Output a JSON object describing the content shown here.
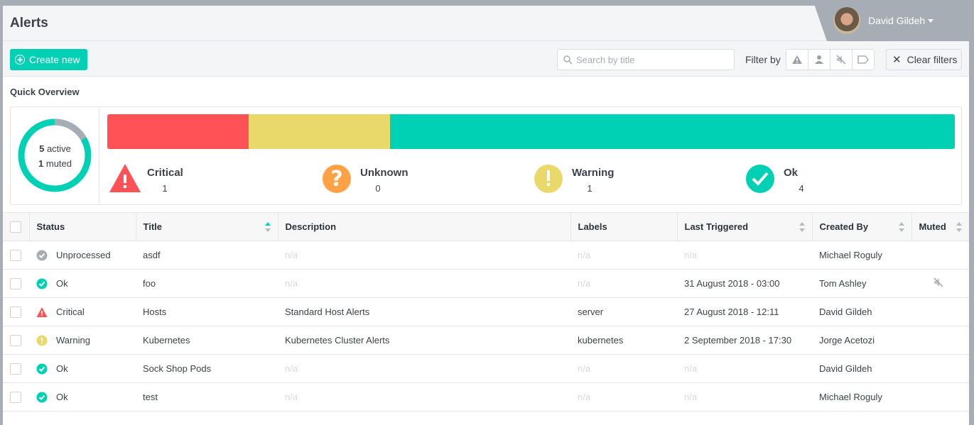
{
  "header": {
    "title": "Alerts",
    "user_name": "David Gildeh"
  },
  "toolbar": {
    "create_label": "Create new",
    "search_placeholder": "Search by title",
    "filter_label": "Filter by",
    "filter_icons": [
      "warning-icon",
      "user-icon",
      "muted-icon",
      "label-icon"
    ],
    "clear_label": "Clear filters"
  },
  "overview": {
    "title": "Quick Overview",
    "active_count": "5",
    "active_label": "active",
    "muted_count": "1",
    "muted_label": "muted",
    "active_fraction": 0.8333,
    "categories": [
      {
        "name": "Critical",
        "count": "1",
        "color": "#ff5257"
      },
      {
        "name": "Unknown",
        "count": "0",
        "color": "#ffa145"
      },
      {
        "name": "Warning",
        "count": "1",
        "color": "#e9d96a"
      },
      {
        "name": "Ok",
        "count": "4",
        "color": "#00d1b5"
      }
    ]
  },
  "table": {
    "columns": [
      "Status",
      "Title",
      "Description",
      "Labels",
      "Last Triggered",
      "Created By",
      "Muted"
    ],
    "rows": [
      {
        "status": "Unprocessed",
        "title": "asdf",
        "description": "n/a",
        "labels": "n/a",
        "last_triggered": "n/a",
        "created_by": "Michael Roguly",
        "muted": false
      },
      {
        "status": "Ok",
        "title": "foo",
        "description": "n/a",
        "labels": "n/a",
        "last_triggered": "31 August 2018 - 03:00",
        "created_by": "Tom Ashley",
        "muted": true
      },
      {
        "status": "Critical",
        "title": "Hosts",
        "description": "Standard Host Alerts",
        "labels": "server",
        "last_triggered": "27 August 2018 - 12:11",
        "created_by": "David Gildeh",
        "muted": false
      },
      {
        "status": "Warning",
        "title": "Kubernetes",
        "description": "Kubernetes Cluster Alerts",
        "labels": "kubernetes",
        "last_triggered": "2 September 2018 - 17:30",
        "created_by": "Jorge Acetozi",
        "muted": false
      },
      {
        "status": "Ok",
        "title": "Sock Shop Pods",
        "description": "n/a",
        "labels": "n/a",
        "last_triggered": "n/a",
        "created_by": "David Gildeh",
        "muted": false
      },
      {
        "status": "Ok",
        "title": "test",
        "description": "n/a",
        "labels": "n/a",
        "last_triggered": "n/a",
        "created_by": "Michael Roguly",
        "muted": false
      }
    ]
  }
}
